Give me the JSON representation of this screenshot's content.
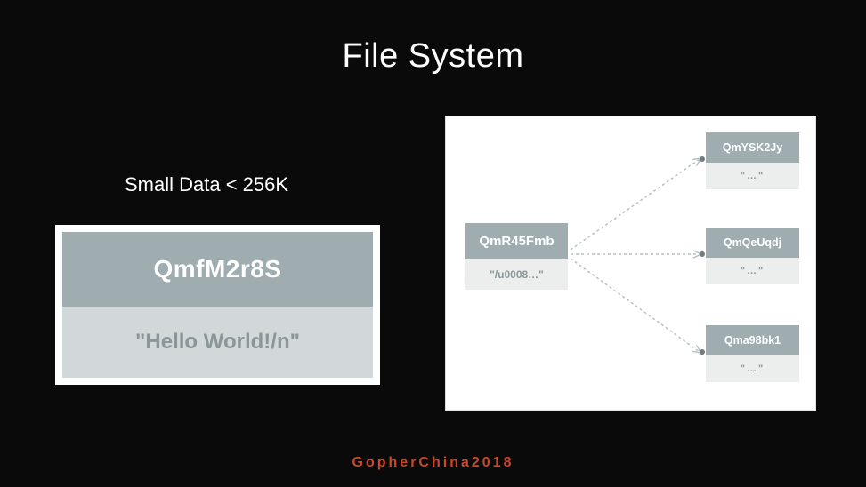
{
  "title": "File System",
  "subtitle": "Small Data < 256K",
  "footer": "GopherChina2018",
  "left_block": {
    "hash": "QmfM2r8S",
    "content": "\"Hello World!/n\""
  },
  "right_panel": {
    "root": {
      "hash": "QmR45Fmb",
      "content": "\"/u0008…\""
    },
    "children": [
      {
        "hash": "QmYSK2Jy",
        "content": "\"…\""
      },
      {
        "hash": "QmQeUqdj",
        "content": "\"…\""
      },
      {
        "hash": "Qma98bk1",
        "content": "\"…\""
      }
    ]
  }
}
